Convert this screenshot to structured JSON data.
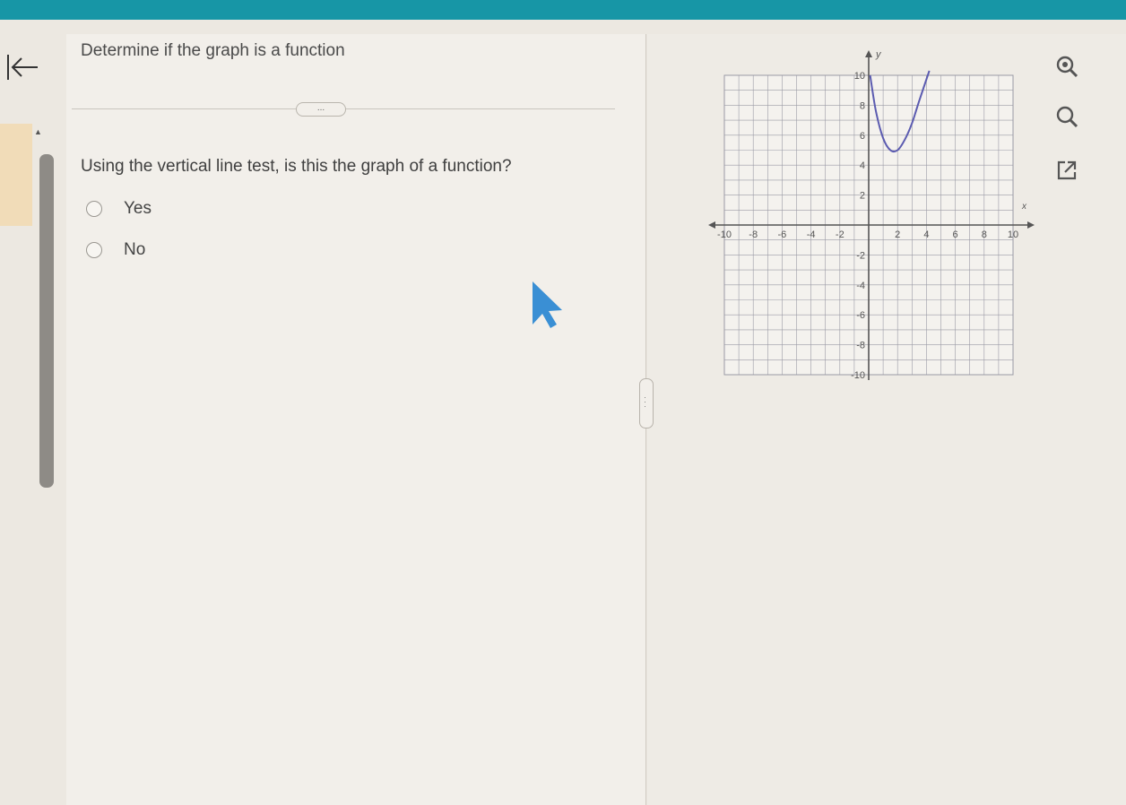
{
  "question": {
    "headline": "Determine if the graph is a function",
    "prompt": "Using the vertical line test, is this the graph of a function?",
    "options": [
      {
        "label": "Yes",
        "selected": false
      },
      {
        "label": "No",
        "selected": false
      }
    ],
    "more_label": "..."
  },
  "icons": {
    "back": "back-arrow-icon",
    "zoom_in": "zoom-in-icon",
    "zoom_out": "zoom-out-icon",
    "popout": "popout-icon",
    "cursor": "mouse-pointer-icon"
  },
  "colors": {
    "header": "#1796a6",
    "curve": "#5b5bb0",
    "grid": "#9a9aa5",
    "cursor": "#3a8fd4",
    "sidebar_accent": "#f1dcb8"
  },
  "chart_data": {
    "type": "line",
    "xlabel": "x",
    "ylabel": "y",
    "xlim": [
      -10,
      10
    ],
    "ylim": [
      -10,
      10
    ],
    "grid": true,
    "x_ticks": [
      -10,
      -8,
      -6,
      -4,
      -2,
      2,
      4,
      6,
      8,
      10
    ],
    "y_ticks": [
      10,
      8,
      6,
      4,
      2,
      -2,
      -4,
      -6,
      -8,
      -10
    ],
    "series": [
      {
        "x": [
          0.1,
          0.5,
          1,
          1.5,
          2,
          2.5,
          3,
          3.5,
          4.2
        ],
        "y": [
          10,
          7.6,
          5.8,
          5.0,
          5.0,
          5.7,
          6.8,
          8.3,
          10.3
        ]
      }
    ]
  }
}
